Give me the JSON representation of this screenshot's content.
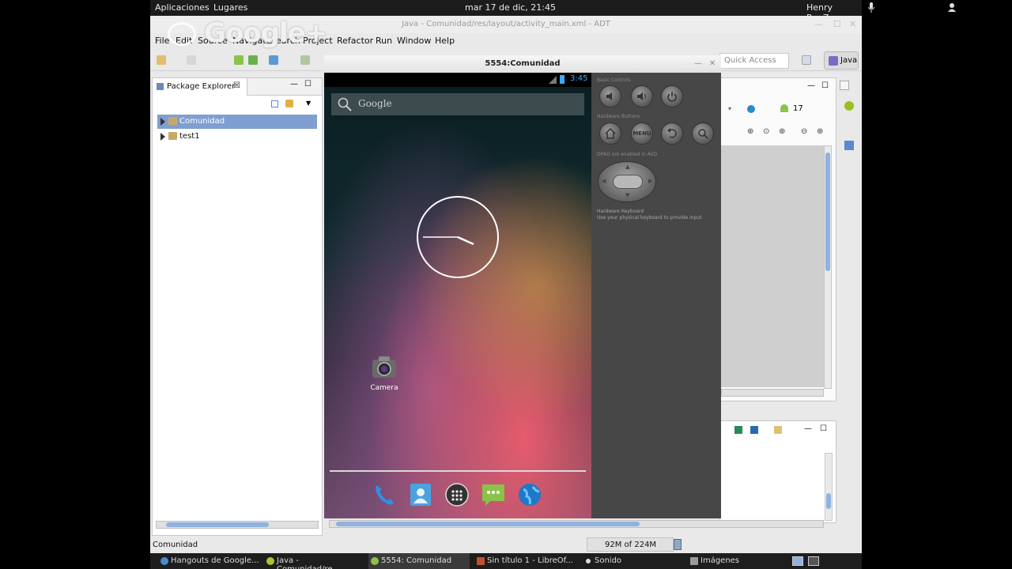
{
  "topbar": {
    "applications": "Aplicaciones",
    "places": "Lugares",
    "datetime": "mar 17 de dic, 21:45",
    "user": "Henry RenZa"
  },
  "eclipse": {
    "title": "Java - Comunidad/res/layout/activity_main.xml - ADT",
    "watermark": "Google+",
    "menu": [
      "File",
      "Edit",
      "Source",
      "Navigate",
      "Search",
      "Project",
      "Refactor",
      "Run",
      "Window",
      "Help"
    ],
    "quick_access": "Quick Access",
    "perspective": "Java",
    "api_level": "17"
  },
  "package_explorer": {
    "tab_label": "Package Explorer",
    "tab_close": "☒",
    "projects": [
      {
        "name": "Comunidad",
        "selected": true
      },
      {
        "name": "test1",
        "selected": false
      }
    ]
  },
  "status": {
    "selection": "Comunidad",
    "heap": "92M of 224M"
  },
  "emulator": {
    "title": "5554:Comunidad",
    "time": "3:45",
    "search_label": "Google",
    "camera_label": "Camera",
    "controls": {
      "basic_controls": "Basic Controls",
      "hardware_buttons": "Hardware Buttons",
      "menu_label": "MENU",
      "dpad_note": "DPAD not enabled in AVD",
      "keyboard_title": "Hardware Keyboard",
      "keyboard_note": "Use your physical keyboard to provide input"
    },
    "dock_icons": [
      "phone-icon",
      "contacts-icon",
      "apps-icon",
      "messaging-icon",
      "browser-icon"
    ]
  },
  "taskbar": {
    "tasks": [
      {
        "label": "Hangouts de Google...",
        "active": false
      },
      {
        "label": "Java - Comunidad/re...",
        "active": false
      },
      {
        "label": "5554: Comunidad",
        "active": true
      },
      {
        "label": "Sin título 1 - LibreOf...",
        "active": false
      },
      {
        "label": "Sonido",
        "active": false
      },
      {
        "label": "Imágenes",
        "active": false
      }
    ]
  },
  "colors": {
    "selection": "#7f9fd2",
    "status_blue": "#3fa9f5",
    "android_green": "#8bc34a"
  }
}
